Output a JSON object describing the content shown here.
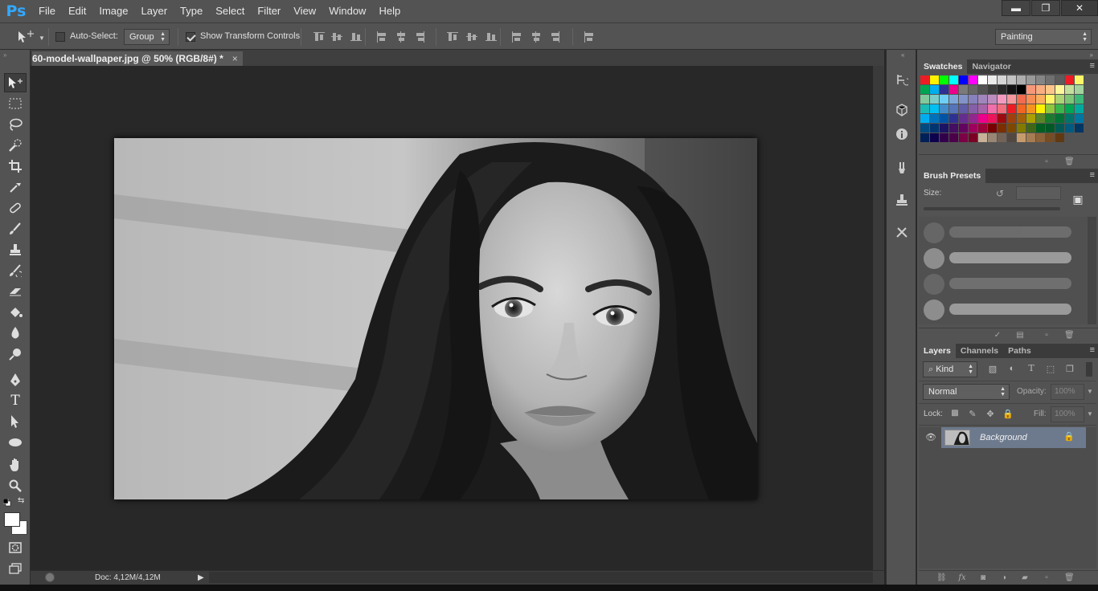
{
  "app": {
    "logo": "Ps"
  },
  "menu": [
    "File",
    "Edit",
    "Image",
    "Layer",
    "Type",
    "Select",
    "Filter",
    "View",
    "Window",
    "Help"
  ],
  "window_controls": {
    "minimize": "▬",
    "restore": "❐",
    "close": "✕"
  },
  "options": {
    "auto_select_label": "Auto-Select:",
    "auto_select_checked": false,
    "auto_select_target": "Group",
    "transform_label": "Show Transform Controls",
    "transform_checked": true,
    "workspace": "Painting"
  },
  "document": {
    "tab_title": "60-model-wallpaper.jpg @ 50% (RGB/8#) *",
    "close": "×",
    "status_doc": "Doc: 4,12M/4,12M"
  },
  "swatches": {
    "tabs": [
      "Swatches",
      "Navigator"
    ],
    "colors": [
      "#ed1c24",
      "#fff200",
      "#00ff00",
      "#00ffff",
      "#0000ff",
      "#ff00ff",
      "#ffffff",
      "#ebebeb",
      "#d6d6d6",
      "#c2c2c2",
      "#adadad",
      "#999999",
      "#858585",
      "#707070",
      "#5c5c5c",
      "#ed1c24",
      "#fff568",
      "#00a651",
      "#00aeef",
      "#2e3192",
      "#ec008c",
      "#7a7a7a",
      "#666666",
      "#525252",
      "#3d3d3d",
      "#292929",
      "#141414",
      "#000000",
      "#f7977a",
      "#f9ad81",
      "#fdc689",
      "#fff799",
      "#c4df9b",
      "#a3d39c",
      "#82ca9c",
      "#7accc8",
      "#6dcff6",
      "#7da7d9",
      "#8393ca",
      "#8781bd",
      "#a186be",
      "#bd8cbf",
      "#f49ac1",
      "#f5989d",
      "#f26c4f",
      "#f68e56",
      "#fbaf5d",
      "#fff568",
      "#acd373",
      "#7cc576",
      "#3bb878",
      "#1abbb4",
      "#00bff3",
      "#438ccb",
      "#5574b9",
      "#605ca8",
      "#855fa8",
      "#a763a8",
      "#f06eaa",
      "#f26d7d",
      "#ed1c24",
      "#f26522",
      "#f7941d",
      "#fff200",
      "#8dc63f",
      "#39b54a",
      "#00a651",
      "#00a99d",
      "#00aeef",
      "#0072bc",
      "#0054a6",
      "#2e3192",
      "#662d91",
      "#92278f",
      "#ec008c",
      "#ed145b",
      "#9e0b0f",
      "#a0410d",
      "#a36209",
      "#aba000",
      "#598527",
      "#197b30",
      "#007236",
      "#00746b",
      "#0076a3",
      "#004a80",
      "#003471",
      "#1b1464",
      "#440e62",
      "#630460",
      "#9e005d",
      "#9e0039",
      "#790000",
      "#7b2e00",
      "#7d4900",
      "#827b00",
      "#406618",
      "#005e20",
      "#005826",
      "#005952",
      "#005b7f",
      "#003663",
      "#002157",
      "#0d004c",
      "#32004b",
      "#4b0049",
      "#7b0046",
      "#7a0026",
      "#c7b299",
      "#998675",
      "#736357",
      "#534741",
      "#c69c6d",
      "#a67c52",
      "#8c6239",
      "#754c24",
      "#603913"
    ]
  },
  "brush_presets": {
    "tab": "Brush Presets",
    "size_label": "Size:"
  },
  "layers": {
    "tabs": [
      "Layers",
      "Channels",
      "Paths"
    ],
    "kind_label": "Kind",
    "blend_mode": "Normal",
    "opacity_label": "Opacity:",
    "opacity_value": "100%",
    "lock_label": "Lock:",
    "fill_label": "Fill:",
    "fill_value": "100%",
    "items": [
      {
        "name": "Background",
        "visible": true,
        "locked": true
      }
    ]
  }
}
